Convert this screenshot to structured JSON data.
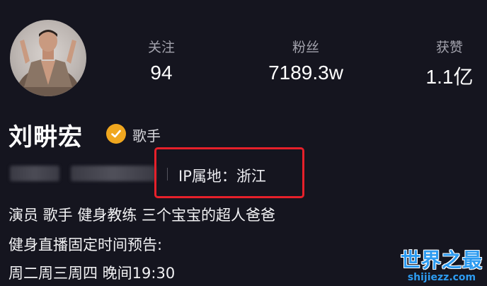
{
  "profile": {
    "name": "刘畊宏",
    "role_label": "歌手",
    "ip_location": "IP属地：浙江",
    "bio_lines": [
      "演员 歌手 健身教练 三个宝宝的超人爸爸",
      "健身直播固定时间预告:",
      "周二周三周四 晚间19:30"
    ]
  },
  "stats": {
    "following": {
      "label": "关注",
      "value": "94"
    },
    "followers": {
      "label": "粉丝",
      "value": "7189.3w"
    },
    "likes": {
      "label": "获赞",
      "value": "1.1亿"
    }
  },
  "watermark": {
    "title": "世界之最",
    "url": "shijiezz.com"
  },
  "colors": {
    "background": "#15151f",
    "highlight": "#e6202a",
    "badge": "#f0a71f",
    "watermark": "#2d9bf0"
  },
  "icons": {
    "verified_badge": "check-badge-icon"
  }
}
